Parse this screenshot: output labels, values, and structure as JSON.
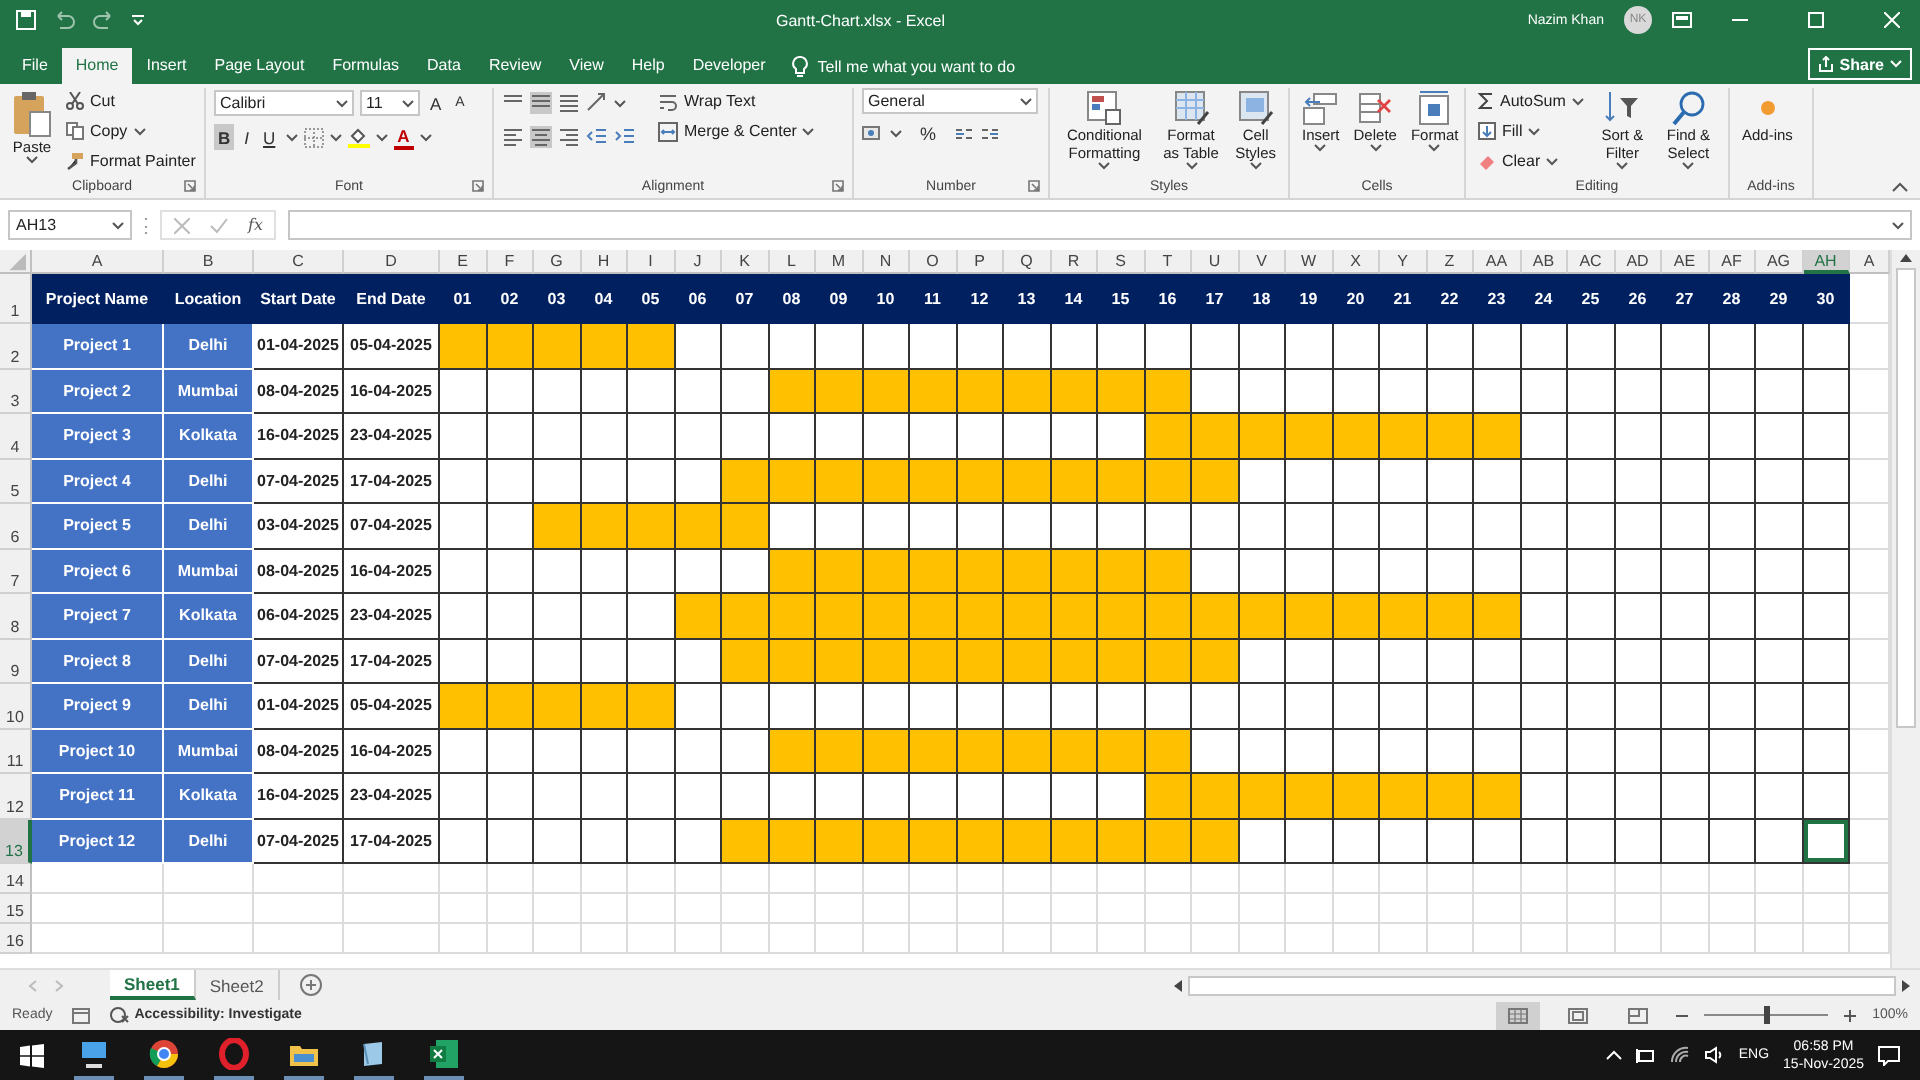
{
  "title_bar": {
    "title": "Gantt-Chart.xlsx  -  Excel",
    "user": "Nazim Khan",
    "avatar_initials": "NK"
  },
  "menu_tabs": [
    {
      "label": "File",
      "selected": false
    },
    {
      "label": "Home",
      "selected": true
    },
    {
      "label": "Insert",
      "selected": false
    },
    {
      "label": "Page Layout",
      "selected": false
    },
    {
      "label": "Formulas",
      "selected": false
    },
    {
      "label": "Data",
      "selected": false
    },
    {
      "label": "Review",
      "selected": false
    },
    {
      "label": "View",
      "selected": false
    },
    {
      "label": "Help",
      "selected": false
    },
    {
      "label": "Developer",
      "selected": false
    }
  ],
  "tell_me": "Tell me what you want to do",
  "share": "Share",
  "ribbon": {
    "clipboard": {
      "label": "Clipboard",
      "paste": "Paste",
      "cut": "Cut",
      "copy": "Copy",
      "format_painter": "Format Painter"
    },
    "font": {
      "label": "Font",
      "name": "Calibri",
      "size": "11",
      "grow": "A",
      "shrink": "A",
      "bold": "B",
      "bold_pressed": true,
      "italic": "I",
      "underline": "U",
      "font_color": "A"
    },
    "alignment": {
      "label": "Alignment",
      "middle_pressed": true,
      "center_pressed": true,
      "wrap_text": "Wrap Text",
      "merge_center": "Merge & Center"
    },
    "number": {
      "label": "Number",
      "format": "General",
      "percent": "%"
    },
    "styles": {
      "label": "Styles",
      "conditional": "Conditional Formatting",
      "format_table": "Format as Table",
      "cell_styles": "Cell Styles"
    },
    "cells": {
      "label": "Cells",
      "insert": "Insert",
      "delete": "Delete",
      "format": "Format"
    },
    "editing": {
      "label": "Editing",
      "autosum": "AutoSum",
      "fill": "Fill",
      "clear": "Clear",
      "sort_filter": "Sort & Filter",
      "find_select": "Find & Select"
    },
    "addins": {
      "label": "Add-ins",
      "button": "Add-ins"
    }
  },
  "formula_bar": {
    "name_box": "AH13",
    "fx": "fx"
  },
  "columns": [
    {
      "label": "A",
      "selected": false
    },
    {
      "label": "B",
      "selected": false
    },
    {
      "label": "C",
      "selected": false
    },
    {
      "label": "D",
      "selected": false
    },
    {
      "label": "E",
      "selected": false
    },
    {
      "label": "F",
      "selected": false
    },
    {
      "label": "G",
      "selected": false
    },
    {
      "label": "H",
      "selected": false
    },
    {
      "label": "I",
      "selected": false
    },
    {
      "label": "J",
      "selected": false
    },
    {
      "label": "K",
      "selected": false
    },
    {
      "label": "L",
      "selected": false
    },
    {
      "label": "M",
      "selected": false
    },
    {
      "label": "N",
      "selected": false
    },
    {
      "label": "O",
      "selected": false
    },
    {
      "label": "P",
      "selected": false
    },
    {
      "label": "Q",
      "selected": false
    },
    {
      "label": "R",
      "selected": false
    },
    {
      "label": "S",
      "selected": false
    },
    {
      "label": "T",
      "selected": false
    },
    {
      "label": "U",
      "selected": false
    },
    {
      "label": "V",
      "selected": false
    },
    {
      "label": "W",
      "selected": false
    },
    {
      "label": "X",
      "selected": false
    },
    {
      "label": "Y",
      "selected": false
    },
    {
      "label": "Z",
      "selected": false
    },
    {
      "label": "AA",
      "selected": false
    },
    {
      "label": "AB",
      "selected": false
    },
    {
      "label": "AC",
      "selected": false
    },
    {
      "label": "AD",
      "selected": false
    },
    {
      "label": "AE",
      "selected": false
    },
    {
      "label": "AF",
      "selected": false
    },
    {
      "label": "AG",
      "selected": false
    },
    {
      "label": "AH",
      "selected": true
    },
    {
      "label": "A",
      "selected": false
    }
  ],
  "row_numbers": [
    {
      "label": "1",
      "selected": false
    },
    {
      "label": "2",
      "selected": false
    },
    {
      "label": "3",
      "selected": false
    },
    {
      "label": "4",
      "selected": false
    },
    {
      "label": "5",
      "selected": false
    },
    {
      "label": "6",
      "selected": false
    },
    {
      "label": "7",
      "selected": false
    },
    {
      "label": "8",
      "selected": false
    },
    {
      "label": "9",
      "selected": false
    },
    {
      "label": "10",
      "selected": false
    },
    {
      "label": "11",
      "selected": false
    },
    {
      "label": "12",
      "selected": false
    },
    {
      "label": "13",
      "selected": true
    },
    {
      "label": "14",
      "selected": false
    },
    {
      "label": "15",
      "selected": false
    },
    {
      "label": "16",
      "selected": false
    }
  ],
  "header_row": {
    "project": "Project Name",
    "location": "Location",
    "start": "Start Date",
    "end": "End Date",
    "days": [
      "01",
      "02",
      "03",
      "04",
      "05",
      "06",
      "07",
      "08",
      "09",
      "10",
      "11",
      "12",
      "13",
      "14",
      "15",
      "16",
      "17",
      "18",
      "19",
      "20",
      "21",
      "22",
      "23",
      "24",
      "25",
      "26",
      "27",
      "28",
      "29",
      "30"
    ]
  },
  "rows": [
    {
      "project": "Project 1",
      "location": "Delhi",
      "start": "01-04-2025",
      "end": "05-04-2025",
      "filled": [
        true,
        true,
        true,
        true,
        true,
        false,
        false,
        false,
        false,
        false,
        false,
        false,
        false,
        false,
        false,
        false,
        false,
        false,
        false,
        false,
        false,
        false,
        false,
        false,
        false,
        false,
        false,
        false,
        false,
        false
      ]
    },
    {
      "project": "Project 2",
      "location": "Mumbai",
      "start": "08-04-2025",
      "end": "16-04-2025",
      "filled": [
        false,
        false,
        false,
        false,
        false,
        false,
        false,
        true,
        true,
        true,
        true,
        true,
        true,
        true,
        true,
        true,
        false,
        false,
        false,
        false,
        false,
        false,
        false,
        false,
        false,
        false,
        false,
        false,
        false,
        false
      ]
    },
    {
      "project": "Project 3",
      "location": "Kolkata",
      "start": "16-04-2025",
      "end": "23-04-2025",
      "filled": [
        false,
        false,
        false,
        false,
        false,
        false,
        false,
        false,
        false,
        false,
        false,
        false,
        false,
        false,
        false,
        true,
        true,
        true,
        true,
        true,
        true,
        true,
        true,
        false,
        false,
        false,
        false,
        false,
        false,
        false
      ]
    },
    {
      "project": "Project 4",
      "location": "Delhi",
      "start": "07-04-2025",
      "end": "17-04-2025",
      "filled": [
        false,
        false,
        false,
        false,
        false,
        false,
        true,
        true,
        true,
        true,
        true,
        true,
        true,
        true,
        true,
        true,
        true,
        false,
        false,
        false,
        false,
        false,
        false,
        false,
        false,
        false,
        false,
        false,
        false,
        false
      ]
    },
    {
      "project": "Project 5",
      "location": "Delhi",
      "start": "03-04-2025",
      "end": "07-04-2025",
      "filled": [
        false,
        false,
        true,
        true,
        true,
        true,
        true,
        false,
        false,
        false,
        false,
        false,
        false,
        false,
        false,
        false,
        false,
        false,
        false,
        false,
        false,
        false,
        false,
        false,
        false,
        false,
        false,
        false,
        false,
        false
      ]
    },
    {
      "project": "Project 6",
      "location": "Mumbai",
      "start": "08-04-2025",
      "end": "16-04-2025",
      "filled": [
        false,
        false,
        false,
        false,
        false,
        false,
        false,
        true,
        true,
        true,
        true,
        true,
        true,
        true,
        true,
        true,
        false,
        false,
        false,
        false,
        false,
        false,
        false,
        false,
        false,
        false,
        false,
        false,
        false,
        false
      ]
    },
    {
      "project": "Project 7",
      "location": "Kolkata",
      "start": "06-04-2025",
      "end": "23-04-2025",
      "filled": [
        false,
        false,
        false,
        false,
        false,
        true,
        true,
        true,
        true,
        true,
        true,
        true,
        true,
        true,
        true,
        true,
        true,
        true,
        true,
        true,
        true,
        true,
        true,
        false,
        false,
        false,
        false,
        false,
        false,
        false
      ]
    },
    {
      "project": "Project 8",
      "location": "Delhi",
      "start": "07-04-2025",
      "end": "17-04-2025",
      "filled": [
        false,
        false,
        false,
        false,
        false,
        false,
        true,
        true,
        true,
        true,
        true,
        true,
        true,
        true,
        true,
        true,
        true,
        false,
        false,
        false,
        false,
        false,
        false,
        false,
        false,
        false,
        false,
        false,
        false,
        false
      ]
    },
    {
      "project": "Project 9",
      "location": "Delhi",
      "start": "01-04-2025",
      "end": "05-04-2025",
      "filled": [
        true,
        true,
        true,
        true,
        true,
        false,
        false,
        false,
        false,
        false,
        false,
        false,
        false,
        false,
        false,
        false,
        false,
        false,
        false,
        false,
        false,
        false,
        false,
        false,
        false,
        false,
        false,
        false,
        false,
        false
      ]
    },
    {
      "project": "Project 10",
      "location": "Mumbai",
      "start": "08-04-2025",
      "end": "16-04-2025",
      "filled": [
        false,
        false,
        false,
        false,
        false,
        false,
        false,
        true,
        true,
        true,
        true,
        true,
        true,
        true,
        true,
        true,
        false,
        false,
        false,
        false,
        false,
        false,
        false,
        false,
        false,
        false,
        false,
        false,
        false,
        false
      ]
    },
    {
      "project": "Project 11",
      "location": "Kolkata",
      "start": "16-04-2025",
      "end": "23-04-2025",
      "filled": [
        false,
        false,
        false,
        false,
        false,
        false,
        false,
        false,
        false,
        false,
        false,
        false,
        false,
        false,
        false,
        true,
        true,
        true,
        true,
        true,
        true,
        true,
        true,
        false,
        false,
        false,
        false,
        false,
        false,
        false
      ]
    },
    {
      "project": "Project 12",
      "location": "Delhi",
      "start": "07-04-2025",
      "end": "17-04-2025",
      "filled": [
        false,
        false,
        false,
        false,
        false,
        false,
        true,
        true,
        true,
        true,
        true,
        true,
        true,
        true,
        true,
        true,
        true,
        false,
        false,
        false,
        false,
        false,
        false,
        false,
        false,
        false,
        false,
        false,
        false,
        false
      ]
    }
  ],
  "sheet_tabs": [
    {
      "label": "Sheet1",
      "selected": true
    },
    {
      "label": "Sheet2",
      "selected": false
    }
  ],
  "status_bar": {
    "ready": "Ready",
    "accessibility": "Accessibility: Investigate",
    "zoom": "100%",
    "zoom_slider": {
      "level": 0.5
    }
  },
  "taskbar": {
    "language": "ENG",
    "time": "06:58 PM",
    "date": "15-Nov-2025"
  }
}
